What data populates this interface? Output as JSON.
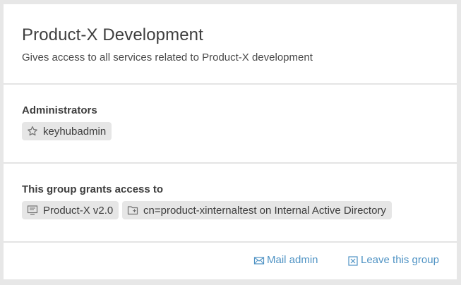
{
  "group": {
    "title": "Product-X Development",
    "description": "Gives access to all services related to Product-X development"
  },
  "administrators": {
    "heading": "Administrators",
    "items": [
      {
        "label": "keyhubadmin",
        "icon": "star-icon"
      }
    ]
  },
  "access": {
    "heading": "This group grants access to",
    "items": [
      {
        "label": "Product-X v2.0",
        "icon": "application-icon"
      },
      {
        "label": "cn=product-xinternaltest on Internal Active Directory",
        "icon": "directory-group-icon"
      }
    ]
  },
  "actions": {
    "mail_admin": {
      "label": "Mail admin",
      "icon": "mail-icon"
    },
    "leave_group": {
      "label": "Leave this group",
      "icon": "close-box-icon"
    }
  },
  "colors": {
    "link": "#4f93c4",
    "tag_background": "#e6e6e6",
    "page_background": "#e7e7e7"
  }
}
